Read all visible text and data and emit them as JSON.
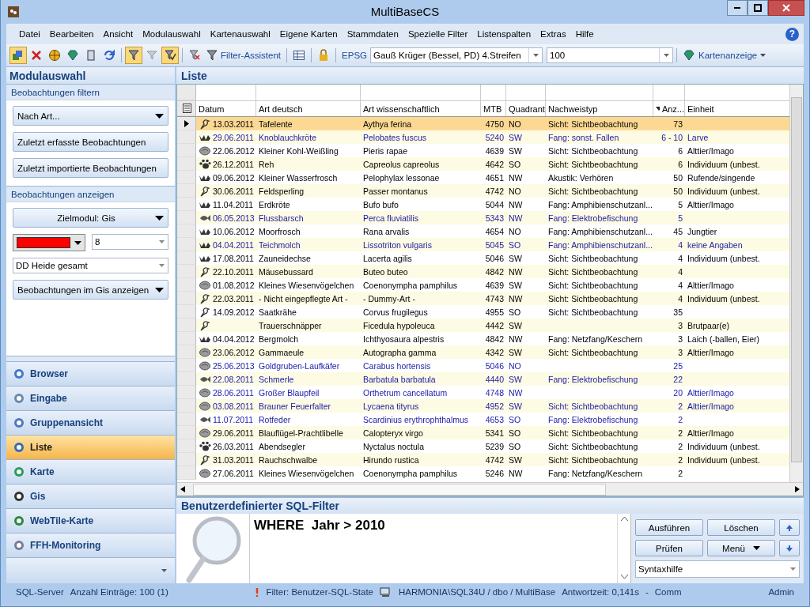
{
  "window": {
    "title": "MultiBaseCS"
  },
  "menu": [
    "Datei",
    "Bearbeiten",
    "Ansicht",
    "Modulauswahl",
    "Kartenauswahl",
    "Eigene Karten",
    "Stammdaten",
    "Spezielle Filter",
    "Listenspalten",
    "Extras",
    "Hilfe"
  ],
  "help_button": "?",
  "toolbar": {
    "icons": [
      {
        "kind": "layers",
        "on": true
      },
      {
        "kind": "delete",
        "on": false
      },
      {
        "kind": "globe",
        "on": false
      },
      {
        "kind": "gem",
        "on": false
      },
      {
        "kind": "book",
        "on": false
      },
      {
        "kind": "refresh",
        "on": false
      },
      {
        "kind": "filter",
        "on": true
      },
      {
        "kind": "unfilter",
        "on": false
      },
      {
        "kind": "filtercheck",
        "on": true
      }
    ],
    "filter_assistant": "Filter-Assistent",
    "epsg_label": "EPSG",
    "projection": "Gauß Krüger (Bessel, PD) 4.Streifen",
    "scale": "100",
    "map_button": "Kartenanzeige"
  },
  "sidebar": {
    "title": "Modulauswahl",
    "filter_section": {
      "title": "Beobachtungen filtern",
      "dropdown": "Nach Art...",
      "buttons": [
        "Zuletzt erfasste Beobachtungen",
        "Zuletzt importierte Beobachtungen"
      ]
    },
    "display_section": {
      "title": "Beobachtungen anzeigen",
      "target": "Zielmodul: Gis",
      "color": "#ff0000",
      "size": "8",
      "area": "DD Heide gesamt",
      "action": "Beobachtungen im Gis anzeigen"
    },
    "items": [
      {
        "label": "Browser",
        "selected": false
      },
      {
        "label": "Eingabe",
        "selected": false
      },
      {
        "label": "Gruppenansicht",
        "selected": false
      },
      {
        "label": "Liste",
        "selected": true
      },
      {
        "label": "Karte",
        "selected": false
      },
      {
        "label": "Gis",
        "selected": false
      },
      {
        "label": "WebTile-Karte",
        "selected": false
      },
      {
        "label": "FFH-Monitoring",
        "selected": false
      }
    ]
  },
  "list": {
    "title": "Liste",
    "columns": [
      {
        "label": "Datum",
        "sorted": false
      },
      {
        "label": "Art deutsch",
        "sorted": false
      },
      {
        "label": "Art wissenschaftlich",
        "sorted": false
      },
      {
        "label": "MTB",
        "sorted": false
      },
      {
        "label": "Quadrant",
        "sorted": false
      },
      {
        "label": "Nachweistyp",
        "sorted": false
      },
      {
        "label": "Anz...",
        "sorted": true
      },
      {
        "label": "Einheit",
        "sorted": false
      }
    ],
    "rows": [
      {
        "kind": "bird",
        "selected": true,
        "highlighted": false,
        "cells": [
          "13.03.2011",
          "Tafelente",
          "Aythya ferina",
          "4750",
          "NO",
          "Sicht: Sichtbeobachtung",
          "73",
          ""
        ]
      },
      {
        "kind": "amphibian",
        "selected": false,
        "highlighted": true,
        "cells": [
          "29.06.2011",
          "Knoblauchkröte",
          "Pelobates fuscus",
          "5240",
          "SW",
          "Fang: sonst. Fallen",
          "6 - 10",
          "Larve"
        ]
      },
      {
        "kind": "insect",
        "selected": false,
        "highlighted": false,
        "cells": [
          "22.06.2012",
          "Kleiner Kohl-Weißling",
          "Pieris rapae",
          "4639",
          "SW",
          "Sicht: Sichtbeobachtung",
          "6",
          "Alttier/Imago"
        ]
      },
      {
        "kind": "mammal",
        "selected": false,
        "highlighted": false,
        "cells": [
          "26.12.2011",
          "Reh",
          "Capreolus capreolus",
          "4642",
          "SO",
          "Sicht: Sichtbeobachtung",
          "6",
          "Individuum (unbest."
        ]
      },
      {
        "kind": "amphibian",
        "selected": false,
        "highlighted": false,
        "cells": [
          "09.06.2012",
          "Kleiner Wasserfrosch",
          "Pelophylax lessonae",
          "4651",
          "NW",
          "Akustik: Verhören",
          "50",
          "Rufende/singende"
        ]
      },
      {
        "kind": "bird",
        "selected": false,
        "highlighted": false,
        "cells": [
          "30.06.2011",
          "Feldsperling",
          "Passer montanus",
          "4742",
          "NO",
          "Sicht: Sichtbeobachtung",
          "50",
          "Individuum (unbest."
        ]
      },
      {
        "kind": "amphibian",
        "selected": false,
        "highlighted": false,
        "cells": [
          "11.04.2011",
          "Erdkröte",
          "Bufo bufo",
          "5044",
          "NW",
          "Fang: Amphibienschutzanl...",
          "5",
          "Alttier/Imago"
        ]
      },
      {
        "kind": "fish",
        "selected": false,
        "highlighted": true,
        "cells": [
          "06.05.2013",
          "Flussbarsch",
          "Perca fluviatilis",
          "5343",
          "NW",
          "Fang: Elektrobefischung",
          "5",
          ""
        ]
      },
      {
        "kind": "amphibian",
        "selected": false,
        "highlighted": false,
        "cells": [
          "10.06.2012",
          "Moorfrosch",
          "Rana arvalis",
          "4654",
          "NO",
          "Fang: Amphibienschutzanl...",
          "45",
          "Jungtier"
        ]
      },
      {
        "kind": "amphibian",
        "selected": false,
        "highlighted": true,
        "cells": [
          "04.04.2011",
          "Teichmolch",
          "Lissotriton vulgaris",
          "5045",
          "SO",
          "Fang: Amphibienschutzanl...",
          "4",
          "keine Angaben"
        ]
      },
      {
        "kind": "amphibian",
        "selected": false,
        "highlighted": false,
        "cells": [
          "17.08.2011",
          "Zauneidechse",
          "Lacerta agilis",
          "5046",
          "SW",
          "Sicht: Sichtbeobachtung",
          "4",
          "Individuum (unbest."
        ]
      },
      {
        "kind": "bird",
        "selected": false,
        "highlighted": false,
        "cells": [
          "22.10.2011",
          "Mäusebussard",
          "Buteo buteo",
          "4842",
          "NW",
          "Sicht: Sichtbeobachtung",
          "4",
          ""
        ]
      },
      {
        "kind": "insect",
        "selected": false,
        "highlighted": false,
        "cells": [
          "01.08.2012",
          "Kleines Wiesenvögelchen",
          "Coenonympha pamphilus",
          "4639",
          "SW",
          "Sicht: Sichtbeobachtung",
          "4",
          "Alttier/Imago"
        ]
      },
      {
        "kind": "bird",
        "selected": false,
        "highlighted": false,
        "cells": [
          "22.03.2011",
          "- Nicht eingepflegte Art -",
          "- Dummy-Art -",
          "4743",
          "NW",
          "Sicht: Sichtbeobachtung",
          "4",
          "Individuum (unbest."
        ]
      },
      {
        "kind": "bird",
        "selected": false,
        "highlighted": false,
        "cells": [
          "14.09.2012",
          "Saatkrähe",
          "Corvus frugilegus",
          "4955",
          "SO",
          "Sicht: Sichtbeobachtung",
          "35",
          ""
        ]
      },
      {
        "kind": "bird",
        "selected": false,
        "highlighted": false,
        "cells": [
          "",
          "Trauerschnäpper",
          "Ficedula hypoleuca",
          "4442",
          "SW",
          "",
          "3",
          "Brutpaar(e)"
        ]
      },
      {
        "kind": "amphibian",
        "selected": false,
        "highlighted": false,
        "cells": [
          "04.04.2012",
          "Bergmolch",
          "Ichthyosaura alpestris",
          "4842",
          "NW",
          "Fang: Netzfang/Keschern",
          "3",
          "Laich (-ballen, Eier)"
        ]
      },
      {
        "kind": "insect",
        "selected": false,
        "highlighted": false,
        "cells": [
          "23.06.2012",
          "Gammaeule",
          "Autographa gamma",
          "4342",
          "SW",
          "Sicht: Sichtbeobachtung",
          "3",
          "Alttier/Imago"
        ]
      },
      {
        "kind": "insect",
        "selected": false,
        "highlighted": true,
        "cells": [
          "25.06.2013",
          "Goldgruben-Laufkäfer",
          "Carabus hortensis",
          "5046",
          "NO",
          "",
          "25",
          ""
        ]
      },
      {
        "kind": "fish",
        "selected": false,
        "highlighted": true,
        "cells": [
          "22.08.2011",
          "Schmerle",
          "Barbatula barbatula",
          "4440",
          "SW",
          "Fang: Elektrobefischung",
          "22",
          ""
        ]
      },
      {
        "kind": "insect",
        "selected": false,
        "highlighted": true,
        "cells": [
          "28.06.2011",
          "Großer Blaupfeil",
          "Orthetrum cancellatum",
          "4748",
          "NW",
          "",
          "20",
          "Alttier/Imago"
        ]
      },
      {
        "kind": "insect",
        "selected": false,
        "highlighted": true,
        "cells": [
          "03.08.2011",
          "Brauner Feuerfalter",
          "Lycaena tityrus",
          "4952",
          "SW",
          "Sicht: Sichtbeobachtung",
          "2",
          "Alttier/Imago"
        ]
      },
      {
        "kind": "fish",
        "selected": false,
        "highlighted": true,
        "cells": [
          "11.07.2011",
          "Rotfeder",
          "Scardinius erythrophthalmus",
          "4653",
          "SO",
          "Fang: Elektrobefischung",
          "2",
          ""
        ]
      },
      {
        "kind": "insect",
        "selected": false,
        "highlighted": false,
        "cells": [
          "29.06.2011",
          "Blauflügel-Prachtlibelle",
          "Calopteryx virgo",
          "5341",
          "SO",
          "Sicht: Sichtbeobachtung",
          "2",
          "Alttier/Imago"
        ]
      },
      {
        "kind": "mammal",
        "selected": false,
        "highlighted": false,
        "cells": [
          "26.03.2011",
          "Abendsegler",
          "Nyctalus noctula",
          "5239",
          "SO",
          "Sicht: Sichtbeobachtung",
          "2",
          "Individuum (unbest."
        ]
      },
      {
        "kind": "bird",
        "selected": false,
        "highlighted": false,
        "cells": [
          "31.03.2011",
          "Rauchschwalbe",
          "Hirundo rustica",
          "4742",
          "SW",
          "Sicht: Sichtbeobachtung",
          "2",
          "Individuum (unbest."
        ]
      },
      {
        "kind": "insect",
        "selected": false,
        "highlighted": false,
        "cells": [
          "27.06.2011",
          "Kleines Wiesenvögelchen",
          "Coenonympha pamphilus",
          "5246",
          "NW",
          "Fang: Netzfang/Keschern",
          "2",
          ""
        ]
      }
    ]
  },
  "sql_filter": {
    "title": "Benutzerdefinierter SQL-Filter",
    "value": "WHERE  Jahr > 2010",
    "buttons": [
      "Ausführen",
      "Löschen",
      "Prüfen"
    ],
    "menu_button": "Menü",
    "syntax_help": "Syntaxhilfe"
  },
  "status_bar": {
    "server": "SQL-Server",
    "count": "Anzahl Einträge: 100 (1)",
    "filter": "Filter: Benutzer-SQL-State",
    "connection": "HARMONIA\\SQL34U / dbo / MultiBase",
    "response": "Antwortzeit: 0,141s",
    "separator": "-",
    "comm": "Comm",
    "user": "Admin"
  }
}
